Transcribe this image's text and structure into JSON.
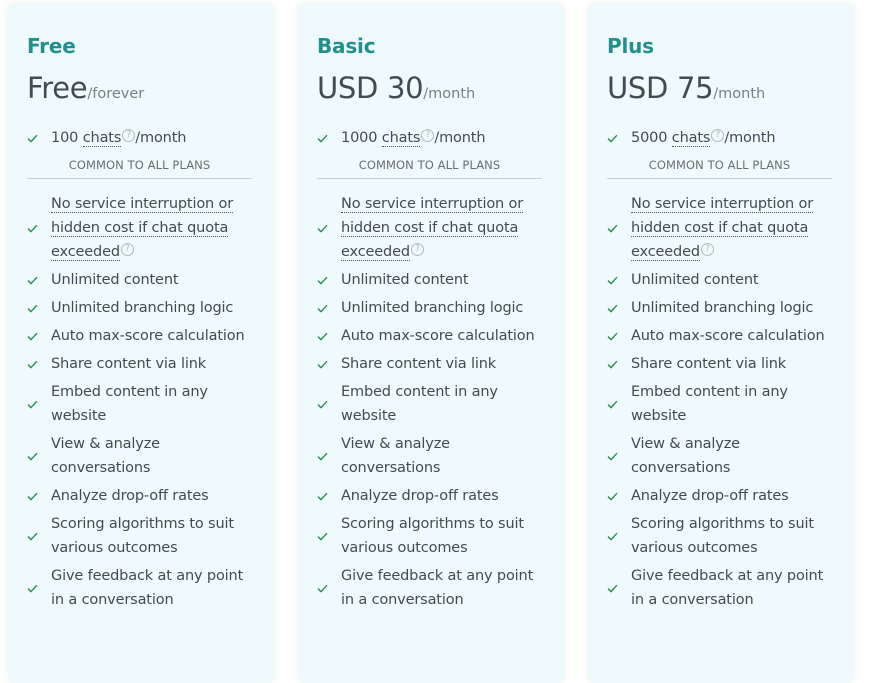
{
  "plans": [
    {
      "name": "Free",
      "price": "Free",
      "period": "/forever",
      "quota": {
        "count": "100",
        "unit": "chats",
        "suffix": "/month"
      }
    },
    {
      "name": "Basic",
      "price": "USD 30",
      "period": "/month",
      "quota": {
        "count": "1000",
        "unit": "chats",
        "suffix": "/month"
      }
    },
    {
      "name": "Plus",
      "price": "USD 75",
      "period": "/month",
      "quota": {
        "count": "5000",
        "unit": "chats",
        "suffix": "/month"
      }
    }
  ],
  "common_label": "COMMON TO ALL PLANS",
  "help_glyph": "?",
  "features": [
    {
      "text": "No service interruption or hidden cost if chat quota exceeded",
      "help": true
    },
    {
      "text": "Unlimited content"
    },
    {
      "text": "Unlimited branching logic"
    },
    {
      "text": "Auto max-score calculation"
    },
    {
      "text": "Share content via link"
    },
    {
      "text": "Embed content in any website"
    },
    {
      "text": "View & analyze conversations"
    },
    {
      "text": "Analyze drop-off rates"
    },
    {
      "text": "Scoring algorithms to suit various outcomes"
    },
    {
      "text": "Give feedback at any point in a conversation"
    }
  ],
  "colors": {
    "accent": "#21908c",
    "check": "#2e8b50",
    "card_bg": "#eefafb"
  }
}
